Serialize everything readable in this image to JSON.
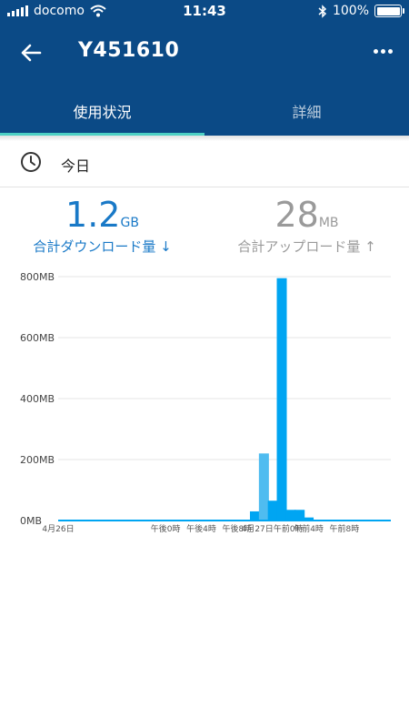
{
  "status_bar": {
    "carrier": "docomo",
    "time": "11:43",
    "battery": "100%",
    "battery_level": 1.0,
    "icons": [
      "signal-bars-icon",
      "wifi-icon",
      "bluetooth-icon",
      "battery-icon"
    ]
  },
  "app_bar": {
    "title": "Y451610",
    "icons": [
      "back-arrow-icon",
      "more-dots-icon"
    ]
  },
  "tabs": [
    {
      "label": "使用状況",
      "selected": true
    },
    {
      "label": "詳細",
      "selected": false
    }
  ],
  "date": {
    "label": "今日",
    "icon": "clock-icon"
  },
  "totals": {
    "download": {
      "value": "1.2",
      "unit": "GB",
      "caption": "合計ダウンロード量 ↓"
    },
    "upload": {
      "value": "28",
      "unit": "MB",
      "caption": "合計アップロード量 ↑"
    }
  },
  "colors": {
    "header": "#0b4a86",
    "accent": "#4dd0c4",
    "download_text": "#1979c7",
    "bar": "#00a5f2",
    "bar_light": "#4fbcf0"
  },
  "chart_data": {
    "type": "bar",
    "y_ticks": [
      "0MB",
      "200MB",
      "400MB",
      "600MB",
      "800MB"
    ],
    "y_tick_values": [
      0,
      200,
      400,
      600,
      800
    ],
    "ylim": [
      0,
      800
    ],
    "x_labels": [
      "4月26日",
      "午後0時",
      "午後4時",
      "午後8時",
      "4月27日",
      "午前0時",
      "午前4時",
      "午前8時"
    ],
    "x_label_hours": [
      0,
      12,
      16,
      20,
      24,
      24,
      28,
      32
    ],
    "hours_domain": [
      0,
      36
    ],
    "bars": [
      {
        "hour": 22,
        "value": 30
      },
      {
        "hour": 23,
        "value": 220
      },
      {
        "hour": 24,
        "value": 65
      },
      {
        "hour": 25,
        "value": 795
      },
      {
        "hour": 26,
        "value": 35
      },
      {
        "hour": 27,
        "value": 35
      },
      {
        "hour": 28,
        "value": 10
      }
    ],
    "grid": true
  }
}
